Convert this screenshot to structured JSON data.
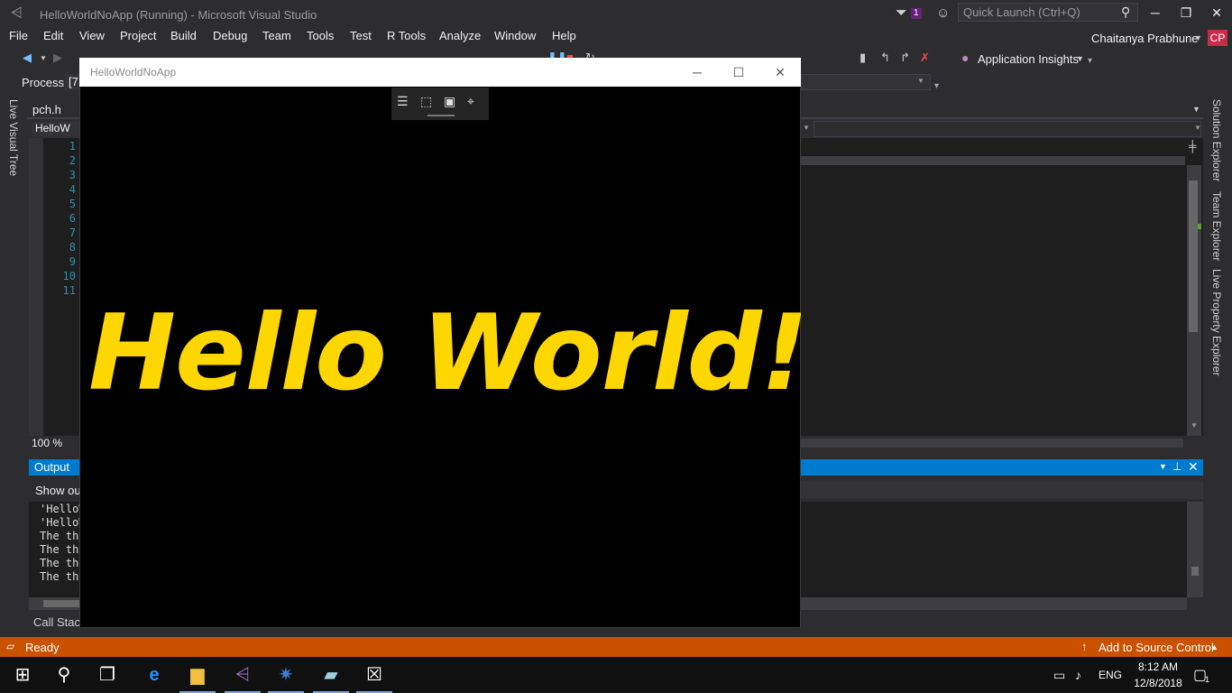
{
  "window": {
    "title": "HelloWorldNoApp (Running) - Microsoft Visual Studio",
    "notification_count": "1",
    "quick_launch_placeholder": "Quick Launch (Ctrl+Q)",
    "minimize": "─",
    "restore": "❐",
    "close": "✕"
  },
  "menu": [
    "File",
    "Edit",
    "View",
    "Project",
    "Build",
    "Debug",
    "Team",
    "Tools",
    "Test",
    "R Tools",
    "Analyze",
    "Window",
    "Help"
  ],
  "user": {
    "name": "Chaitanya Prabhune",
    "initials": "CP"
  },
  "toolbar": {
    "application_insights": "Application Insights",
    "process_label": "Process:",
    "process_value": "[7"
  },
  "side_tabs": {
    "left": "Live Visual Tree",
    "right": [
      "Solution Explorer",
      "Team Explorer",
      "Live Property Explorer"
    ]
  },
  "editor": {
    "tab": "pch.h",
    "project_combo": "HelloW",
    "line_numbers": [
      "1",
      "2",
      "3",
      "4",
      "5",
      "6",
      "7",
      "8",
      "9",
      "10",
      "11"
    ],
    "zoom": "100 %"
  },
  "output": {
    "title": "Output",
    "show_output_from": "Show out",
    "lines": [
      "'HelloW",
      "'HelloW",
      "The thr",
      "The thr",
      "The thr",
      "The thr"
    ],
    "callstack_tab": "Call Stack"
  },
  "app": {
    "title": "HelloWorldNoApp",
    "hello_text": "Hello World!!!",
    "minimize": "─",
    "maximize": "☐",
    "close": "✕"
  },
  "status": {
    "text": "Ready",
    "source_control": "Add to Source Control"
  },
  "taskbar": {
    "lang": "ENG",
    "time": "8:12 AM",
    "date": "12/8/2018",
    "notifications": "1"
  },
  "colors": {
    "accent": "#007acc",
    "status_bar": "#ca5100",
    "hello_text": "#ffd700",
    "user_badge": "#c72c48"
  }
}
